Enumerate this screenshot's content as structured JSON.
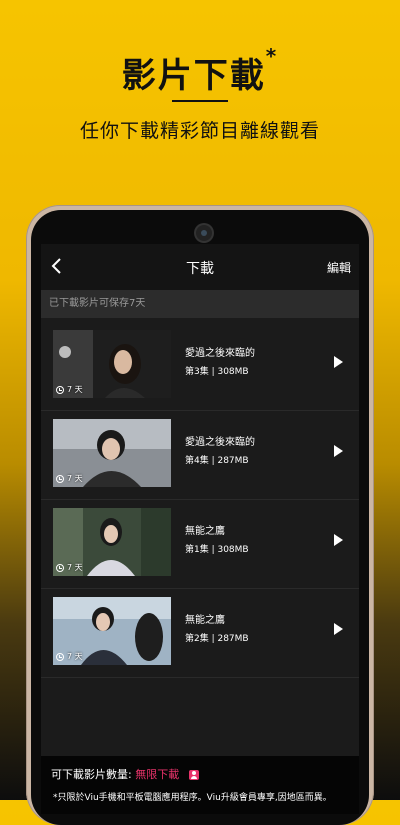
{
  "promo": {
    "title": "影片下載",
    "title_mark": "*",
    "subtitle": "任你下載精彩節目離線觀看"
  },
  "appbar": {
    "title": "下載",
    "edit": "編輯"
  },
  "notice": "已下載影片可保存7天",
  "items": [
    {
      "title": "愛過之後來臨的",
      "meta": "第3集  |  308MB",
      "badge": "7 天"
    },
    {
      "title": "愛過之後來臨的",
      "meta": "第4集  |  287MB",
      "badge": "7 天"
    },
    {
      "title": "無能之鷹",
      "meta": "第1集  |  308MB",
      "badge": "7 天"
    },
    {
      "title": "無能之鷹",
      "meta": "第2集  |  287MB",
      "badge": "7 天"
    }
  ],
  "footer": {
    "quota_label": "可下載影片數量:",
    "quota_value": "無限下載",
    "disclaimer": "*只限於Viu手機和平板電腦應用程序。Viu升級會員專享,因地區而異。"
  },
  "colors": {
    "accent": "#e8336a",
    "promo_bg": "#f6c400"
  }
}
